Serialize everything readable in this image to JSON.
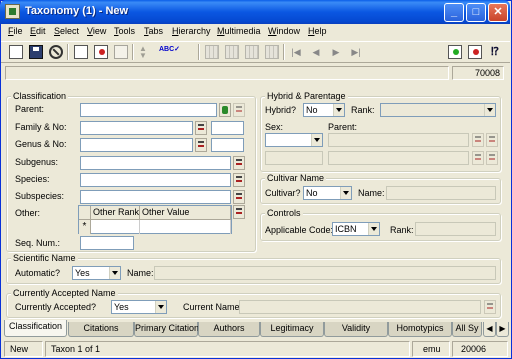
{
  "window": {
    "title": "Taxonomy (1) - New",
    "controls": {
      "minimize": "_",
      "maximize": "□",
      "close": "✕"
    }
  },
  "menu": [
    "File",
    "Edit",
    "Select",
    "View",
    "Tools",
    "Tabs",
    "Hierarchy",
    "Multimedia",
    "Window",
    "Help"
  ],
  "toolbar": {
    "icons": [
      "new-record-icon",
      "save-icon",
      "stop-icon",
      "add-doc-icon",
      "delete-doc-icon",
      "copy-doc-icon",
      "sort-icon",
      "spell-check-icon",
      "grid-view-icon",
      "list-view-icon",
      "table-view-icon",
      "detail-view-icon",
      "first-record-icon",
      "previous-record-icon",
      "next-record-icon",
      "last-record-icon",
      "green-doc-icon",
      "red-doc-icon",
      "context-help-icon"
    ]
  },
  "record_number": "70008",
  "classification": {
    "legend": "Classification",
    "parent": "Parent:",
    "family": "Family & No:",
    "genus": "Genus & No:",
    "subgenus": "Subgenus:",
    "species": "Species:",
    "subspecies": "Subspecies:",
    "other": "Other:",
    "grid_cols": [
      "Other Rank",
      "Other Value"
    ],
    "grid_new_row": "*",
    "seq": "Seq. Num.:"
  },
  "hybrid": {
    "legend": "Hybrid & Parentage",
    "hybrid_label": "Hybrid?",
    "hybrid_value": "No",
    "rank_label": "Rank:",
    "sex_label": "Sex:",
    "parent_label": "Parent:"
  },
  "cultivar": {
    "legend": "Cultivar Name",
    "cultivar_label": "Cultivar?",
    "cultivar_value": "No",
    "name_label": "Name:"
  },
  "controls": {
    "legend": "Controls",
    "code_label": "Applicable Code:",
    "code_value": "ICBN",
    "rank_label": "Rank:"
  },
  "scientific": {
    "legend": "Scientific Name",
    "automatic_label": "Automatic?",
    "automatic_value": "Yes",
    "name_label": "Name:"
  },
  "accepted": {
    "legend": "Currently Accepted Name",
    "accepted_label": "Currently Accepted?",
    "accepted_value": "Yes",
    "current_name_label": "Current Name:"
  },
  "tabs": [
    "Classification",
    "Citations",
    "Primary Citation",
    "Authors",
    "Legitimacy",
    "Validity",
    "Homotypics",
    "All Sy"
  ],
  "status": {
    "mode": "New",
    "position": "Taxon 1 of 1",
    "user": "emu",
    "count": "20006"
  }
}
